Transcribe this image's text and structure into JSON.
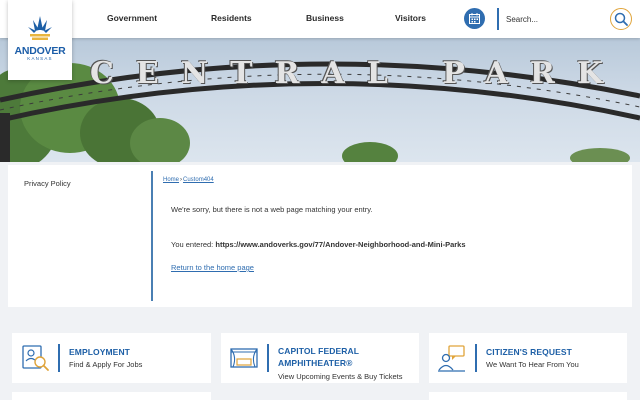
{
  "header": {
    "logo": {
      "name": "ANDOVER",
      "state": "KANSAS"
    },
    "nav": [
      "Government",
      "Residents",
      "Business",
      "Visitors"
    ],
    "search_placeholder": "Search...",
    "icons": {
      "calendar": "calendar-icon",
      "search": "magnifier-icon"
    }
  },
  "hero": {
    "arch_text": "CENTRAL PARK"
  },
  "sidebar": {
    "privacy_policy": "Privacy Policy"
  },
  "breadcrumb": {
    "home": "Home",
    "separator": "›",
    "current": "Custom404"
  },
  "error": {
    "message": "We're sorry, but there is not a web page matching your entry.",
    "entered_label": "You entered:",
    "entered_url": "https://www.andoverks.gov/77/Andover-Neighborhood-and-Mini-Parks",
    "home_link": "Return to the home page"
  },
  "quick_links": [
    {
      "title": "EMPLOYMENT",
      "subtitle": "Find & Apply For Jobs",
      "icon": "job-search-icon"
    },
    {
      "title_line1": "CAPITOL FEDERAL",
      "title_line2": "AMPHITHEATER®",
      "subtitle": "View Upcoming Events & Buy Tickets",
      "icon": "stage-icon"
    },
    {
      "title": "CITIZEN'S REQUEST",
      "subtitle": "We Want To Hear From You",
      "icon": "chat-person-icon"
    }
  ],
  "colors": {
    "brand_blue": "#1d5fa6",
    "accent_gold": "#e0a43a",
    "link_blue": "#2f6db0"
  }
}
